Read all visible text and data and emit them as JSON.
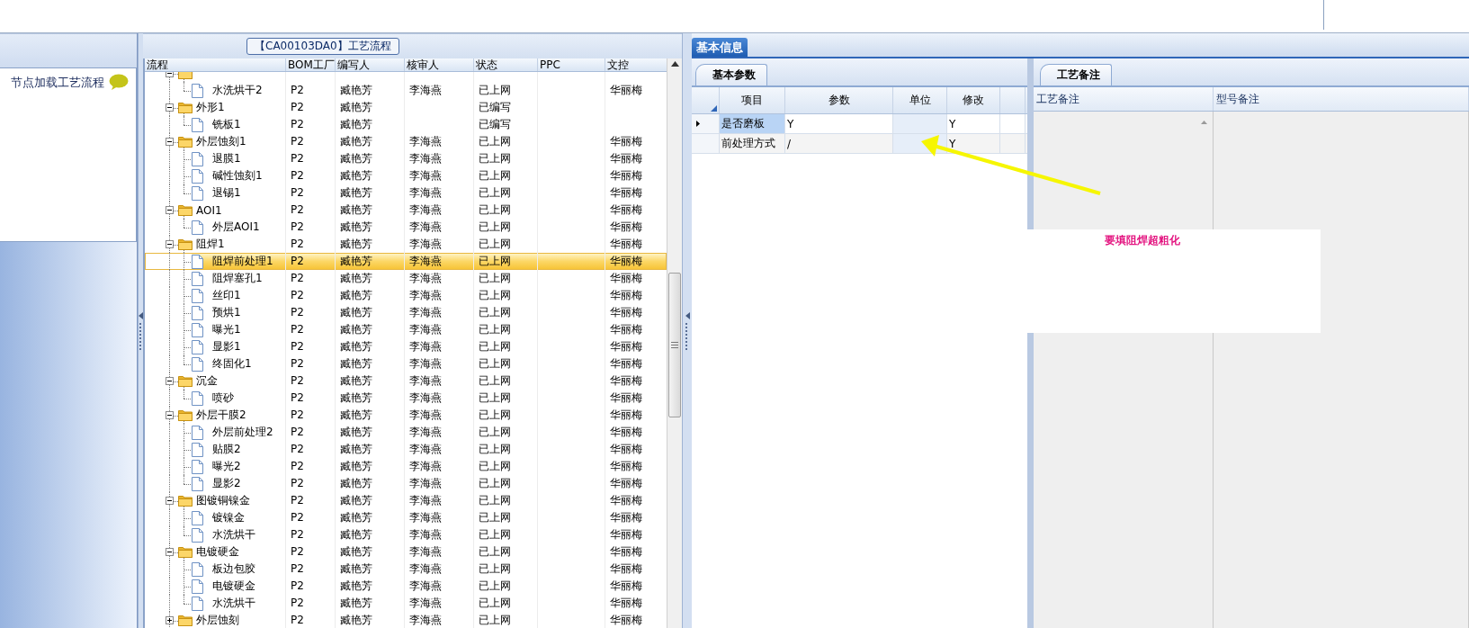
{
  "left_panel": {
    "hint": "节点加载工艺流程"
  },
  "process_panel": {
    "title": "【CA00103DA0】工艺流程",
    "columns": [
      "流程",
      "BOM工厂",
      "编写人",
      "核审人",
      "状态",
      "PPC",
      "文控"
    ],
    "tree": [
      {
        "kind": "folder",
        "expanded": true,
        "selected": false,
        "children": [
          {
            "kind": "leaf",
            "label": "水洗烘干2",
            "selected": false,
            "bom": "P2",
            "writer": "臧艳芳",
            "reviewer": "李海燕",
            "status": "已上网",
            "doc_control": "华丽梅"
          }
        ]
      },
      {
        "kind": "folder",
        "label": "外形1",
        "expanded": true,
        "selected": false,
        "bom": "P2",
        "writer": "臧艳芳",
        "status": "已编写",
        "children": [
          {
            "kind": "leaf",
            "label": "铣板1",
            "selected": false,
            "bom": "P2",
            "writer": "臧艳芳",
            "status": "已编写"
          }
        ]
      },
      {
        "kind": "folder",
        "label": "外层蚀刻1",
        "expanded": true,
        "selected": false,
        "bom": "P2",
        "writer": "臧艳芳",
        "reviewer": "李海燕",
        "status": "已上网",
        "doc_control": "华丽梅",
        "children": [
          {
            "kind": "leaf",
            "label": "退膜1",
            "selected": false,
            "bom": "P2",
            "writer": "臧艳芳",
            "reviewer": "李海燕",
            "status": "已上网",
            "doc_control": "华丽梅"
          },
          {
            "kind": "leaf",
            "label": "碱性蚀刻1",
            "selected": false,
            "bom": "P2",
            "writer": "臧艳芳",
            "reviewer": "李海燕",
            "status": "已上网",
            "doc_control": "华丽梅"
          },
          {
            "kind": "leaf",
            "label": "退锡1",
            "selected": false,
            "bom": "P2",
            "writer": "臧艳芳",
            "reviewer": "李海燕",
            "status": "已上网",
            "doc_control": "华丽梅"
          }
        ]
      },
      {
        "kind": "folder",
        "label": "AOI1",
        "expanded": true,
        "selected": false,
        "bom": "P2",
        "writer": "臧艳芳",
        "reviewer": "李海燕",
        "status": "已上网",
        "doc_control": "华丽梅",
        "children": [
          {
            "kind": "leaf",
            "label": "外层AOI1",
            "selected": false,
            "bom": "P2",
            "writer": "臧艳芳",
            "reviewer": "李海燕",
            "status": "已上网",
            "doc_control": "华丽梅"
          }
        ]
      },
      {
        "kind": "folder",
        "label": "阻焊1",
        "expanded": true,
        "selected": false,
        "bom": "P2",
        "writer": "臧艳芳",
        "reviewer": "李海燕",
        "status": "已上网",
        "doc_control": "华丽梅",
        "children": [
          {
            "kind": "leaf",
            "label": "阻焊前处理1",
            "selected": true,
            "bom": "P2",
            "writer": "臧艳芳",
            "reviewer": "李海燕",
            "status": "已上网",
            "doc_control": "华丽梅"
          },
          {
            "kind": "leaf",
            "label": "阻焊塞孔1",
            "selected": false,
            "bom": "P2",
            "writer": "臧艳芳",
            "reviewer": "李海燕",
            "status": "已上网",
            "doc_control": "华丽梅"
          },
          {
            "kind": "leaf",
            "label": "丝印1",
            "selected": false,
            "bom": "P2",
            "writer": "臧艳芳",
            "reviewer": "李海燕",
            "status": "已上网",
            "doc_control": "华丽梅"
          },
          {
            "kind": "leaf",
            "label": "预烘1",
            "selected": false,
            "bom": "P2",
            "writer": "臧艳芳",
            "reviewer": "李海燕",
            "status": "已上网",
            "doc_control": "华丽梅"
          },
          {
            "kind": "leaf",
            "label": "曝光1",
            "selected": false,
            "bom": "P2",
            "writer": "臧艳芳",
            "reviewer": "李海燕",
            "status": "已上网",
            "doc_control": "华丽梅"
          },
          {
            "kind": "leaf",
            "label": "显影1",
            "selected": false,
            "bom": "P2",
            "writer": "臧艳芳",
            "reviewer": "李海燕",
            "status": "已上网",
            "doc_control": "华丽梅"
          },
          {
            "kind": "leaf",
            "label": "终固化1",
            "selected": false,
            "bom": "P2",
            "writer": "臧艳芳",
            "reviewer": "李海燕",
            "status": "已上网",
            "doc_control": "华丽梅"
          }
        ]
      },
      {
        "kind": "folder",
        "label": "沉金",
        "expanded": true,
        "selected": false,
        "bom": "P2",
        "writer": "臧艳芳",
        "reviewer": "李海燕",
        "status": "已上网",
        "doc_control": "华丽梅",
        "children": [
          {
            "kind": "leaf",
            "label": "喷砂",
            "selected": false,
            "bom": "P2",
            "writer": "臧艳芳",
            "reviewer": "李海燕",
            "status": "已上网",
            "doc_control": "华丽梅"
          }
        ]
      },
      {
        "kind": "folder",
        "label": "外层干膜2",
        "expanded": true,
        "selected": false,
        "bom": "P2",
        "writer": "臧艳芳",
        "reviewer": "李海燕",
        "status": "已上网",
        "doc_control": "华丽梅",
        "children": [
          {
            "kind": "leaf",
            "label": "外层前处理2",
            "selected": false,
            "bom": "P2",
            "writer": "臧艳芳",
            "reviewer": "李海燕",
            "status": "已上网",
            "doc_control": "华丽梅"
          },
          {
            "kind": "leaf",
            "label": "贴膜2",
            "selected": false,
            "bom": "P2",
            "writer": "臧艳芳",
            "reviewer": "李海燕",
            "status": "已上网",
            "doc_control": "华丽梅"
          },
          {
            "kind": "leaf",
            "label": "曝光2",
            "selected": false,
            "bom": "P2",
            "writer": "臧艳芳",
            "reviewer": "李海燕",
            "status": "已上网",
            "doc_control": "华丽梅"
          },
          {
            "kind": "leaf",
            "label": "显影2",
            "selected": false,
            "bom": "P2",
            "writer": "臧艳芳",
            "reviewer": "李海燕",
            "status": "已上网",
            "doc_control": "华丽梅"
          }
        ]
      },
      {
        "kind": "folder",
        "label": "图镀铜镍金",
        "expanded": true,
        "selected": false,
        "bom": "P2",
        "writer": "臧艳芳",
        "reviewer": "李海燕",
        "status": "已上网",
        "doc_control": "华丽梅",
        "children": [
          {
            "kind": "leaf",
            "label": "镀镍金",
            "selected": false,
            "bom": "P2",
            "writer": "臧艳芳",
            "reviewer": "李海燕",
            "status": "已上网",
            "doc_control": "华丽梅"
          },
          {
            "kind": "leaf",
            "label": "水洗烘干",
            "selected": false,
            "bom": "P2",
            "writer": "臧艳芳",
            "reviewer": "李海燕",
            "status": "已上网",
            "doc_control": "华丽梅"
          }
        ]
      },
      {
        "kind": "folder",
        "label": "电镀硬金",
        "expanded": true,
        "selected": false,
        "bom": "P2",
        "writer": "臧艳芳",
        "reviewer": "李海燕",
        "status": "已上网",
        "doc_control": "华丽梅",
        "children": [
          {
            "kind": "leaf",
            "label": "板边包胶",
            "selected": false,
            "bom": "P2",
            "writer": "臧艳芳",
            "reviewer": "李海燕",
            "status": "已上网",
            "doc_control": "华丽梅"
          },
          {
            "kind": "leaf",
            "label": "电镀硬金",
            "selected": false,
            "bom": "P2",
            "writer": "臧艳芳",
            "reviewer": "李海燕",
            "status": "已上网",
            "doc_control": "华丽梅"
          },
          {
            "kind": "leaf",
            "label": "水洗烘干",
            "selected": false,
            "bom": "P2",
            "writer": "臧艳芳",
            "reviewer": "李海燕",
            "status": "已上网",
            "doc_control": "华丽梅"
          }
        ]
      },
      {
        "kind": "folder",
        "label": "外层蚀刻",
        "expanded": false,
        "selected": false,
        "bom": "P2",
        "writer": "臧艳芳",
        "reviewer": "李海燕",
        "status": "已上网",
        "doc_control": "华丽梅"
      }
    ]
  },
  "info_panel": {
    "tabs": [
      {
        "label": "基本信息",
        "selected": true
      }
    ],
    "params": {
      "tab": "基本参数",
      "columns": [
        "项目",
        "参数",
        "单位",
        "修改"
      ],
      "rows": [
        {
          "item": "是否磨板",
          "value": "Y",
          "modify": "Y",
          "selected": true
        },
        {
          "item": "前处理方式",
          "value": "/",
          "modify": "Y",
          "selected": false
        }
      ]
    },
    "remarks": {
      "tab": "工艺备注",
      "columns": [
        "工艺备注",
        "型号备注"
      ]
    }
  },
  "annotation": {
    "note": "要填阻焊超粗化"
  }
}
